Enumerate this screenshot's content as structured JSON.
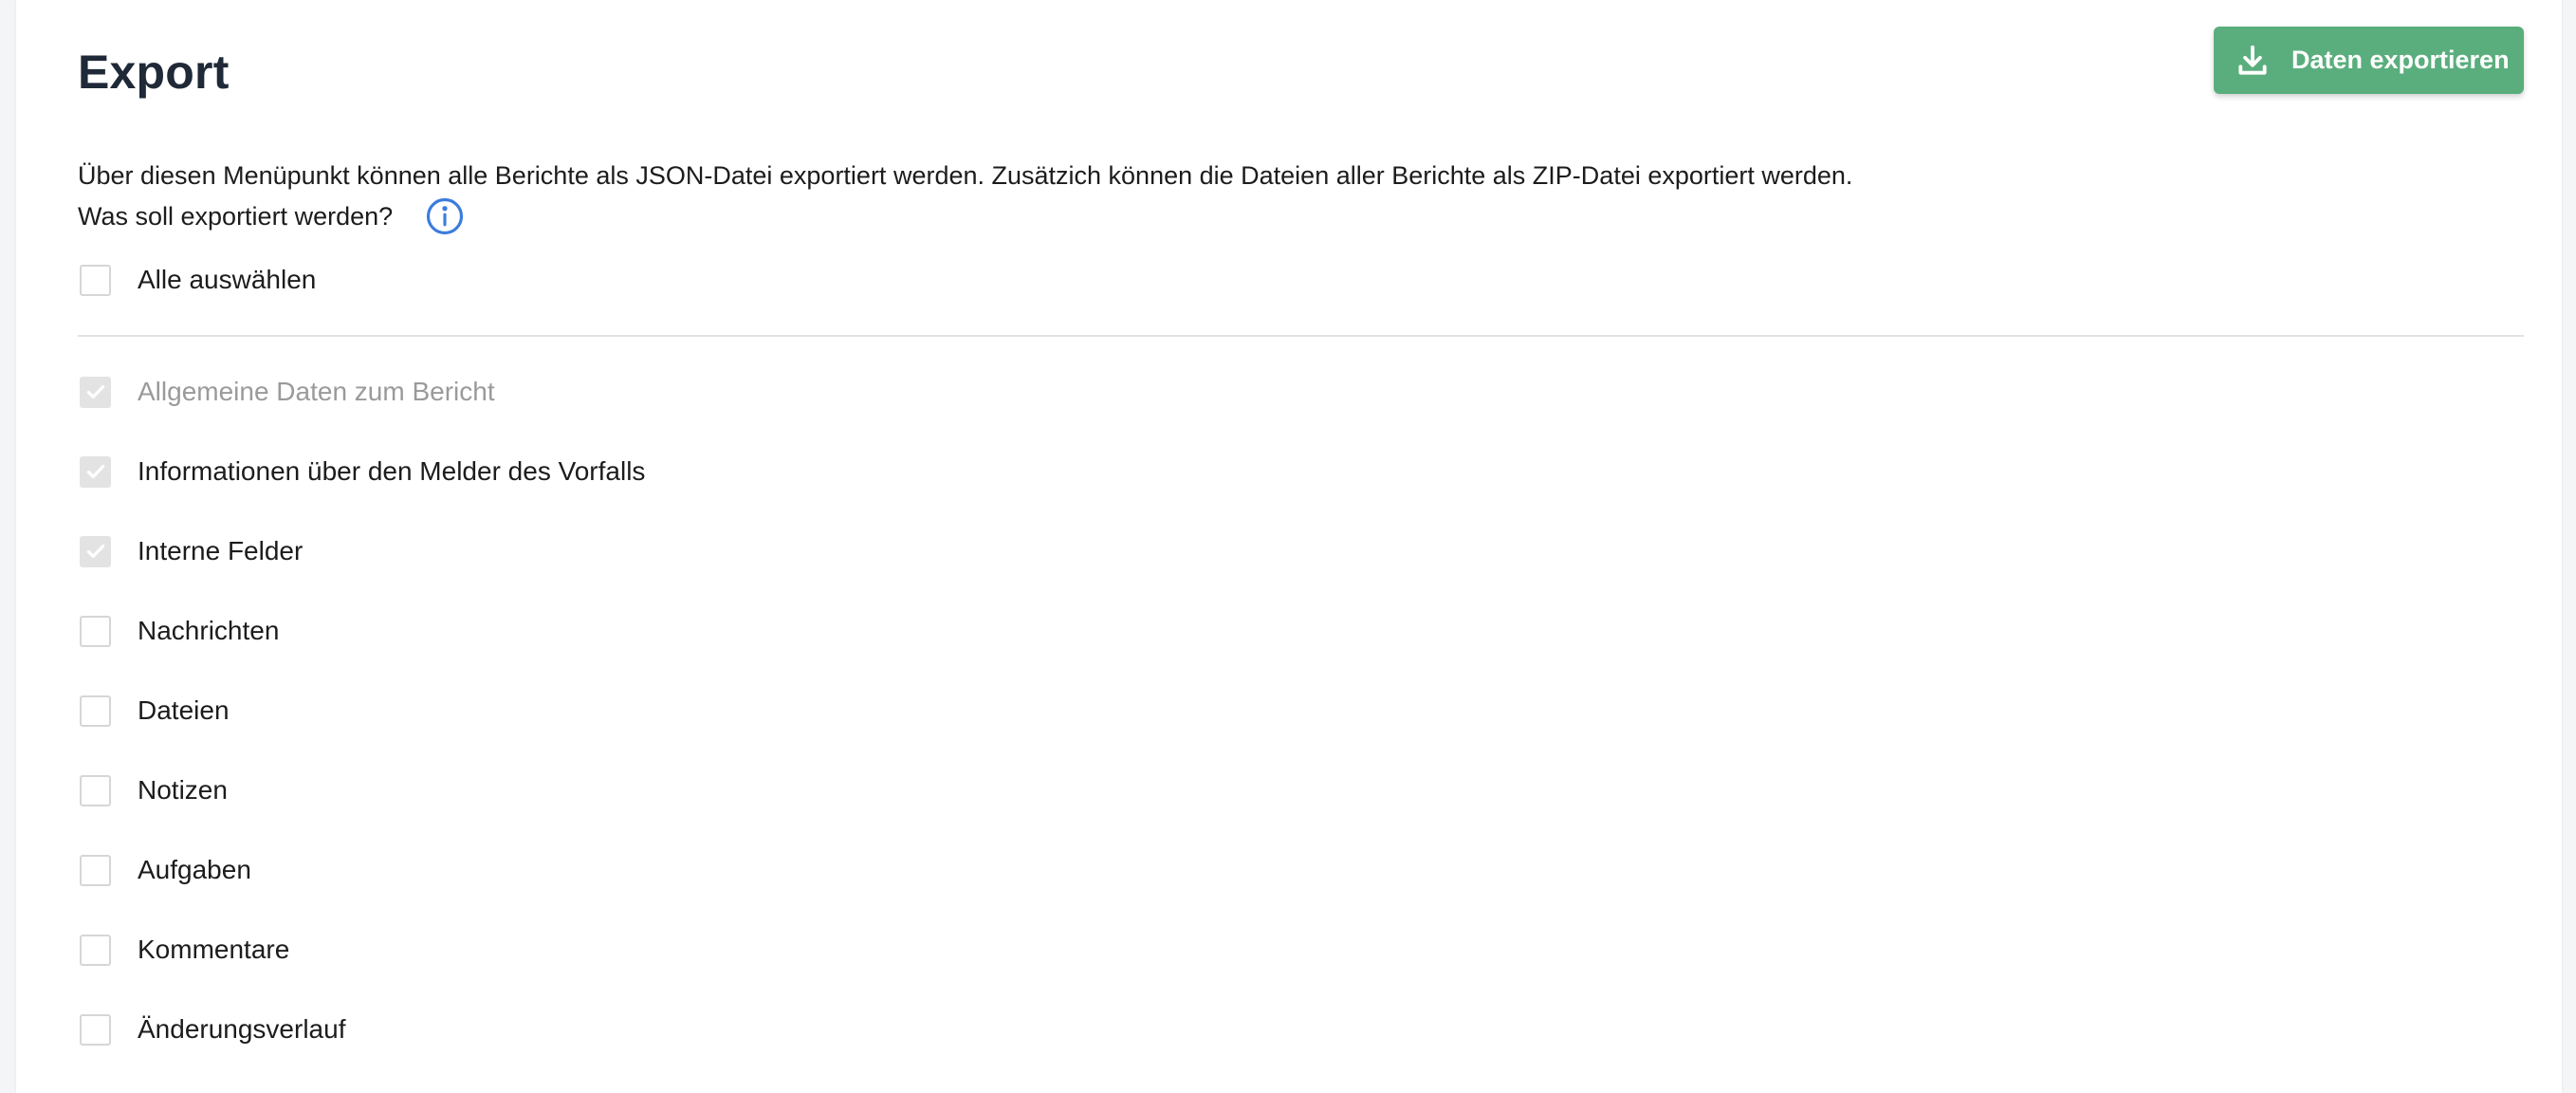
{
  "page": {
    "title": "Export"
  },
  "toolbar": {
    "export_label": "Daten exportieren",
    "export_icon": "download-icon",
    "accent_color": "#5aae7d"
  },
  "description": {
    "line1": "Über diesen Menüpunkt können alle Berichte als JSON-Datei exportiert werden. Zusätzich können die Dateien aller Berichte als ZIP-Datei exportiert werden.",
    "question": "Was soll exportiert werden?",
    "info_icon": "info-icon"
  },
  "select_all": {
    "label": "Alle auswählen",
    "checked": false
  },
  "options": [
    {
      "label": "Allgemeine Daten zum Bericht",
      "checked": true,
      "disabled": true
    },
    {
      "label": "Informationen über den Melder des Vorfalls",
      "checked": true,
      "disabled": false
    },
    {
      "label": "Interne Felder",
      "checked": true,
      "disabled": false
    },
    {
      "label": "Nachrichten",
      "checked": false,
      "disabled": false
    },
    {
      "label": "Dateien",
      "checked": false,
      "disabled": false
    },
    {
      "label": "Notizen",
      "checked": false,
      "disabled": false
    },
    {
      "label": "Aufgaben",
      "checked": false,
      "disabled": false
    },
    {
      "label": "Kommentare",
      "checked": false,
      "disabled": false
    },
    {
      "label": "Änderungsverlauf",
      "checked": false,
      "disabled": false
    }
  ]
}
